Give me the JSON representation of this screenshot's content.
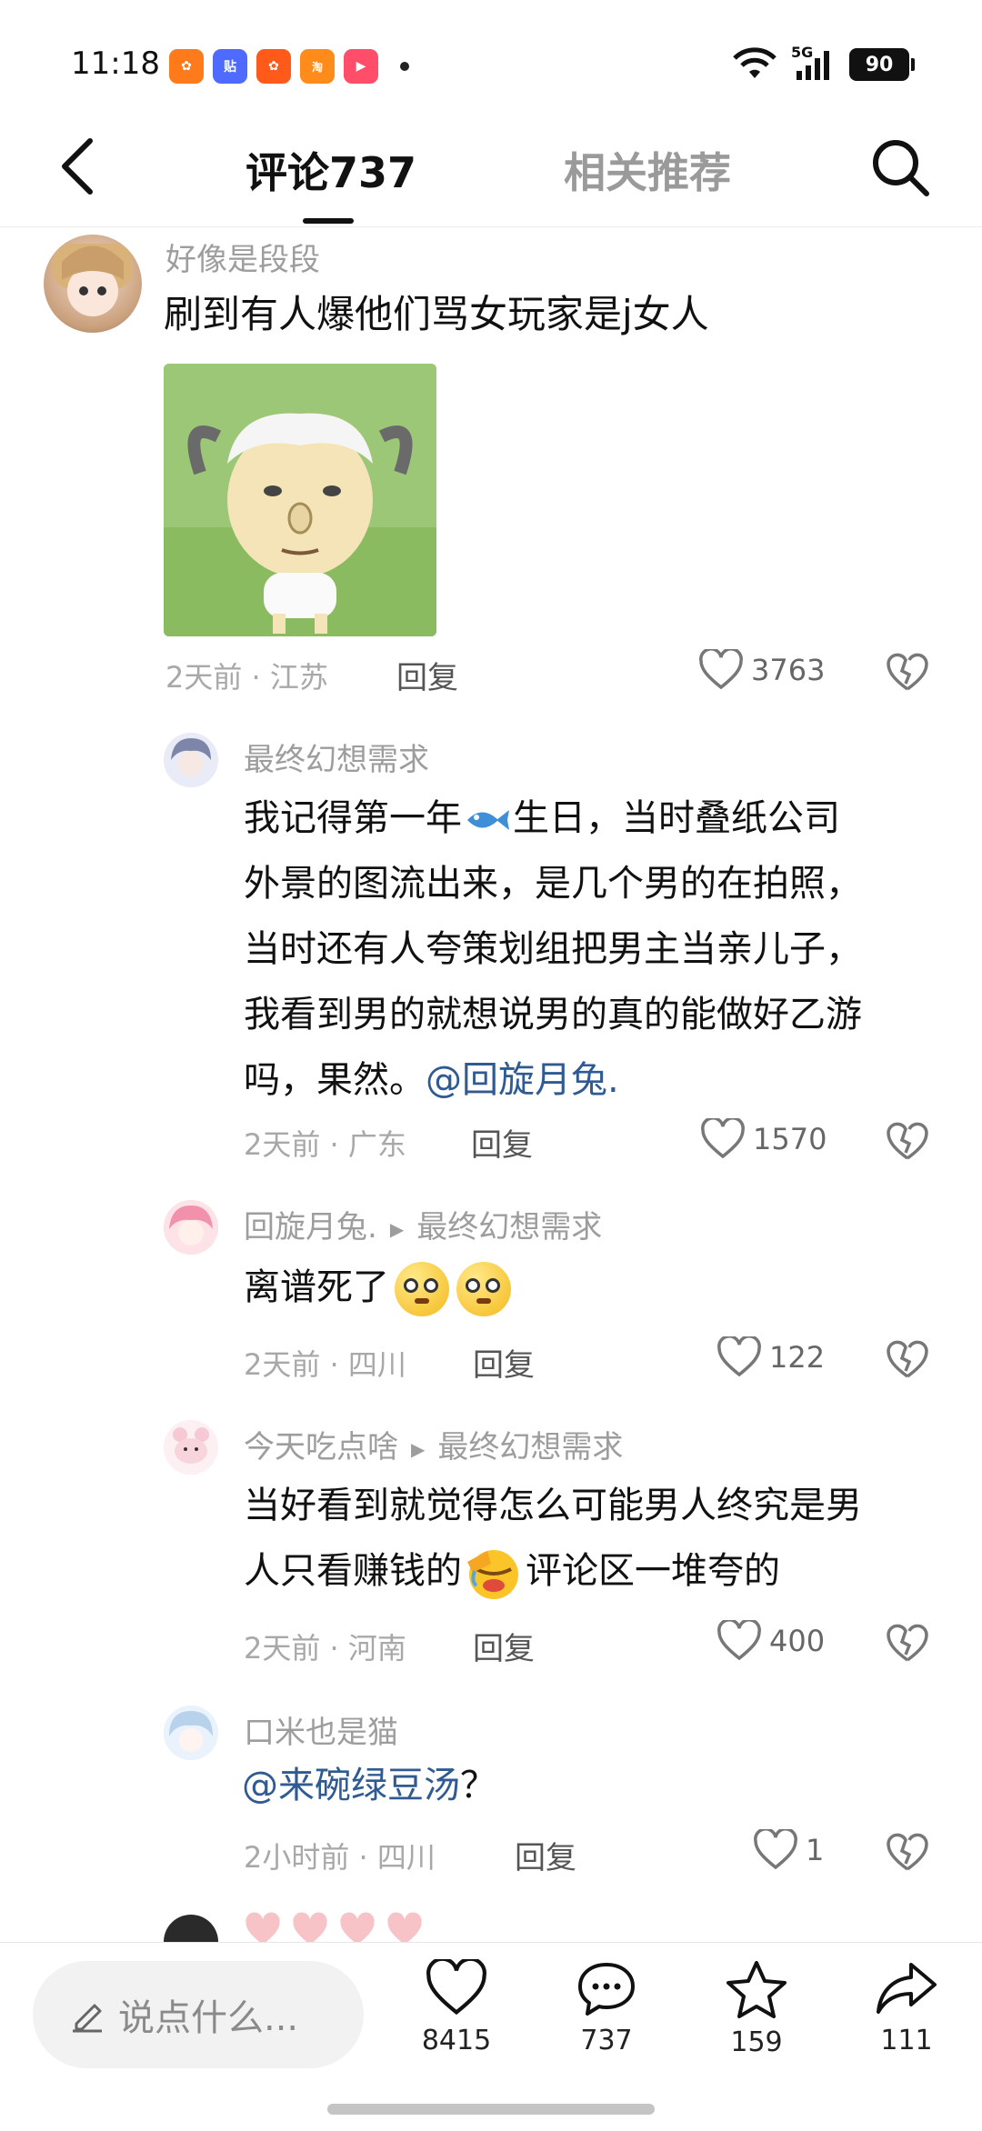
{
  "status_bar": {
    "time": "11:18",
    "app_icons": [
      {
        "name": "kuaishou-icon",
        "color": "#ff7a1a",
        "glyph": "✿"
      },
      {
        "name": "tieba-icon",
        "color": "#4f6bff",
        "glyph": "贴"
      },
      {
        "name": "kuaishou-lite-icon",
        "color": "#ff5a1a",
        "glyph": "✿"
      },
      {
        "name": "taobao-flash-icon",
        "color": "#ff8c1a",
        "glyph": "淘"
      },
      {
        "name": "video-app-icon",
        "color": "#ff4d6a",
        "glyph": "▶"
      }
    ],
    "network": "5G",
    "battery": "90"
  },
  "header": {
    "tab_comments": "评论737",
    "tab_recommend": "相关推荐"
  },
  "comments": [
    {
      "username": "好像是段段",
      "text": "刷到有人爆他们骂女玩家是j女人",
      "time": "2天前",
      "location": "江苏",
      "reply": "回复",
      "likes": "3763"
    },
    {
      "username": "最终幻想需求",
      "lines": [
        "我记得第一年",
        "生日，当时叠纸公司",
        "外景的图流出来，是几个男的在拍照，",
        "当时还有人夸策划组把男主当亲儿子，",
        "我看到男的就想说男的真的能做好乙游",
        "吗，果然。"
      ],
      "mention": "@回旋月兔.",
      "time": "2天前",
      "location": "广东",
      "reply": "回复",
      "likes": "1570"
    },
    {
      "username": "回旋月兔.",
      "reply_to": "最终幻想需求",
      "text": "离谱死了",
      "time": "2天前",
      "location": "四川",
      "reply": "回复",
      "likes": "122"
    },
    {
      "username": "今天吃点啥",
      "reply_to": "最终幻想需求",
      "line1": "当好看到就觉得怎么可能男人终究是男",
      "line2a": "人只看赚钱的",
      "line2b": "评论区一堆夸的",
      "time": "2天前",
      "location": "河南",
      "reply": "回复",
      "likes": "400"
    },
    {
      "username": "口米也是猫",
      "mention": "@来碗绿豆汤",
      "suffix": "？",
      "time": "2小时前",
      "location": "四川",
      "reply": "回复",
      "likes": "1"
    }
  ],
  "bottom_bar": {
    "input_placeholder": "说点什么...",
    "likes": "8415",
    "comments": "737",
    "favorites": "159",
    "shares": "111"
  }
}
